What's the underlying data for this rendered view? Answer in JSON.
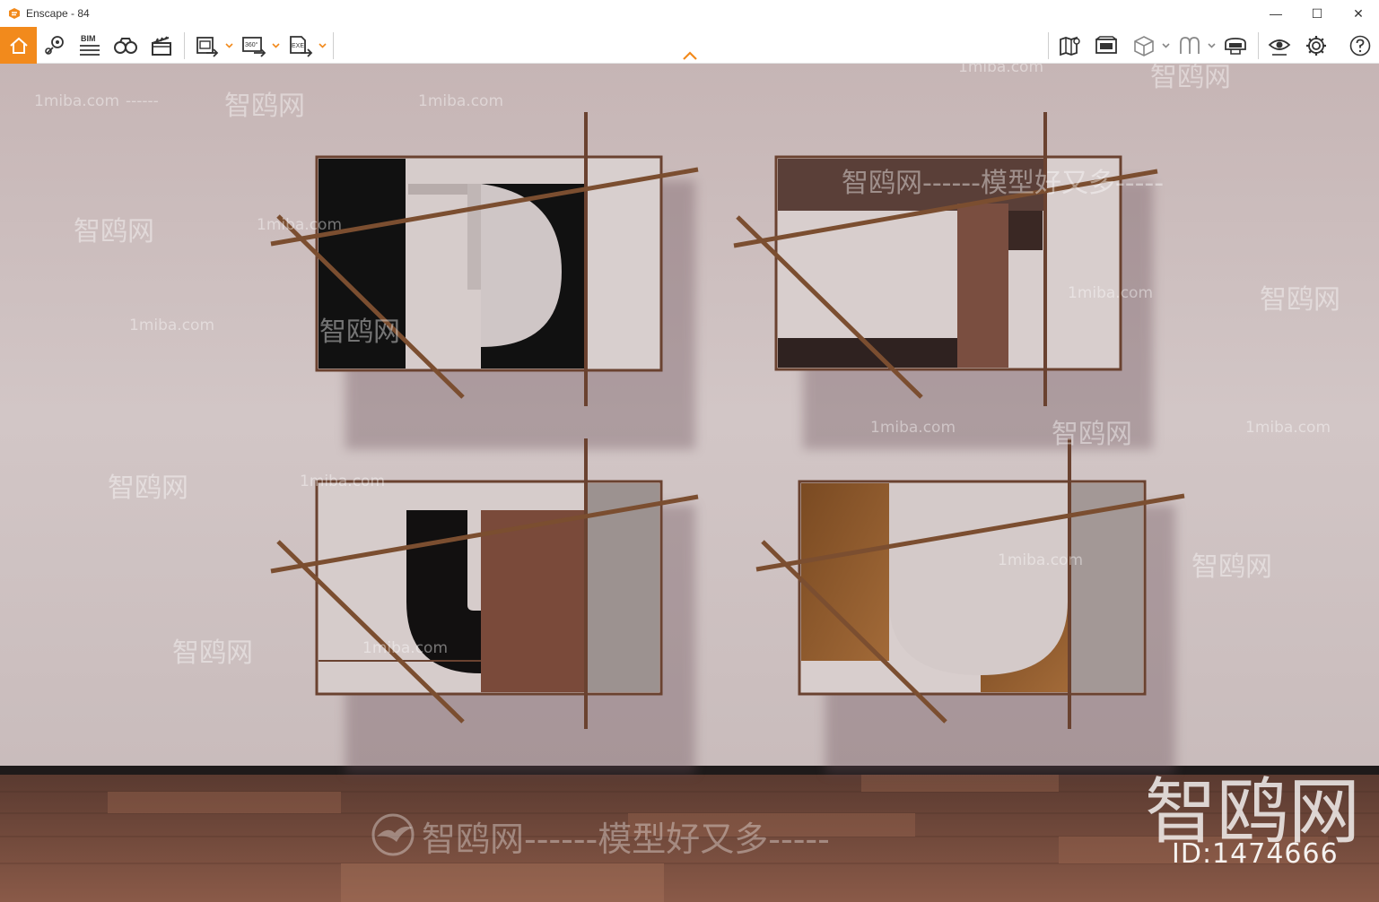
{
  "window": {
    "title": "Enscape - 84",
    "minimize": "—",
    "maximize": "☐",
    "close": "✕"
  },
  "toolbar": {
    "bim_label": "BIM",
    "pano_label": "360°",
    "exe_label": "EXE"
  },
  "colors": {
    "accent": "#f28a1c",
    "wall": "#cdbfbf",
    "floor": "#7a4a3c",
    "frame": "#6a4230",
    "rod": "#7b4e30"
  },
  "watermarks": {
    "site": "1miba.com",
    "brand": "智鸥网",
    "dashes_short": "------",
    "dashes_long": "--------",
    "slogan": "智鸥网------模型好又多-----",
    "slogan_top": "智鸥网------模型好又多-----",
    "big_brand": "智鸥网",
    "id_text": "ID:1474666"
  }
}
